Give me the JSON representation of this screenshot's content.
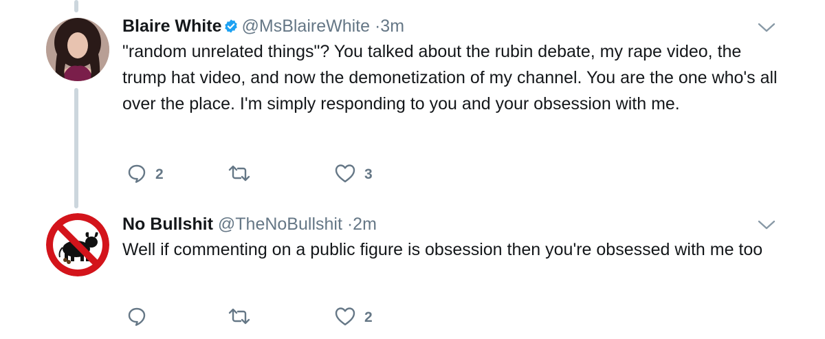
{
  "tweets": [
    {
      "name": "Blaire White",
      "verified": true,
      "handle": "@MsBlaireWhite",
      "time": "·3m",
      "text": "\"random unrelated things\"? You talked about the rubin debate, my rape video, the trump hat video, and now the demonetization of my channel. You are the one who's all over the place. I'm simply responding to you and your obsession with me.",
      "replies": "2",
      "retweets": "",
      "likes": "3"
    },
    {
      "name": "No Bullshit",
      "verified": false,
      "handle": "@TheNoBullshit",
      "time": "·2m",
      "text": "Well if commenting on a public figure is obsession then you're obsessed with me too",
      "replies": "",
      "retweets": "",
      "likes": "2"
    }
  ],
  "icons": {
    "reply": "reply-icon",
    "retweet": "retweet-icon",
    "like": "heart-icon",
    "verified": "verified-badge-icon",
    "caret": "chevron-down-icon"
  },
  "colors": {
    "name": "#14171a",
    "secondary": "#657786",
    "verified": "#1da1f2",
    "thread_line": "#ccd6dd",
    "no_sign_red": "#d3141b"
  }
}
